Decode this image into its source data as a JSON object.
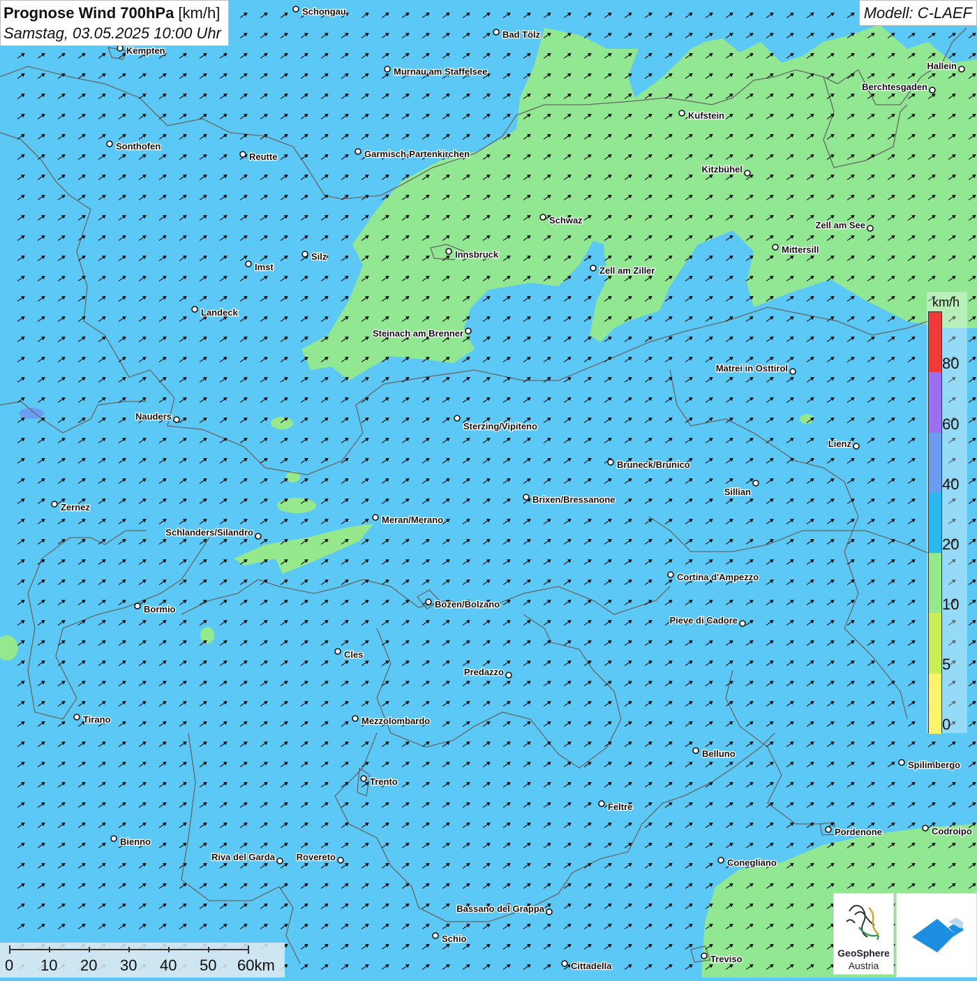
{
  "title": {
    "main_bold": "Prognose Wind 700hPa",
    "main_unit": " [km/h]",
    "datetime": "Samstag, 03.05.2025 10:00 Uhr"
  },
  "model_label": "Modell: C-LAEF",
  "colors": {
    "wind_0_5": "#fbf36a",
    "wind_5_10": "#c8ef5a",
    "wind_10_20": "#95e98c",
    "wind_20_40": "#5cc8f5",
    "wind_40_60": "#6a9df2",
    "wind_60_80": "#9a6ff0",
    "wind_80_plus": "#f03a3a",
    "borders": "#666666",
    "arrows": "#111111"
  },
  "legend": {
    "unit": "km/h",
    "ticks": [
      "80",
      "60",
      "40",
      "20",
      "10",
      "5",
      "0"
    ]
  },
  "cities": [
    {
      "name": "Schongau"
    },
    {
      "name": "Bad Tölz"
    },
    {
      "name": "Kempten"
    },
    {
      "name": "Murnau am Staffelsee"
    },
    {
      "name": "Hallein"
    },
    {
      "name": "Berchtesgaden"
    },
    {
      "name": "Kufstein"
    },
    {
      "name": "Sonthofen"
    },
    {
      "name": "Reutte"
    },
    {
      "name": "Garmisch-Partenkirchen"
    },
    {
      "name": "Kitzbühel"
    },
    {
      "name": "Schwaz"
    },
    {
      "name": "Zell am See"
    },
    {
      "name": "Mittersill"
    },
    {
      "name": "Innsbruck"
    },
    {
      "name": "Silz"
    },
    {
      "name": "Imst"
    },
    {
      "name": "Zell am Ziller"
    },
    {
      "name": "Landeck"
    },
    {
      "name": "Steinach am Brenner"
    },
    {
      "name": "Matrei in Osttirol"
    },
    {
      "name": "Nauders"
    },
    {
      "name": "Sterzing/Vipiteno"
    },
    {
      "name": "Lienz"
    },
    {
      "name": "Bruneck/Brunico"
    },
    {
      "name": "Sillian"
    },
    {
      "name": "Brixen/Bressanone"
    },
    {
      "name": "Zernez"
    },
    {
      "name": "Meran/Merano"
    },
    {
      "name": "Schlanders/Silandro"
    },
    {
      "name": "Cortina d'Ampezzo"
    },
    {
      "name": "Bozen/Bolzano"
    },
    {
      "name": "Bormio"
    },
    {
      "name": "Pieve di Cadore"
    },
    {
      "name": "Cles"
    },
    {
      "name": "Predazzo"
    },
    {
      "name": "Tirano"
    },
    {
      "name": "Mezzolombardo"
    },
    {
      "name": "Belluno"
    },
    {
      "name": "Spilimbergo"
    },
    {
      "name": "Trento"
    },
    {
      "name": "Feltre"
    },
    {
      "name": "Pordenone"
    },
    {
      "name": "Codroipo"
    },
    {
      "name": "Bienno"
    },
    {
      "name": "Riva del Garda"
    },
    {
      "name": "Rovereto"
    },
    {
      "name": "Conegliano"
    },
    {
      "name": "Bassano del Grappa"
    },
    {
      "name": "Schio"
    },
    {
      "name": "Treviso"
    },
    {
      "name": "Cittadella"
    }
  ],
  "scale": {
    "labels": [
      "0",
      "10",
      "20",
      "30",
      "40",
      "50",
      "60km"
    ]
  },
  "logos": {
    "geosphere_line1": "GeoSphere",
    "geosphere_line2": "Austria"
  }
}
